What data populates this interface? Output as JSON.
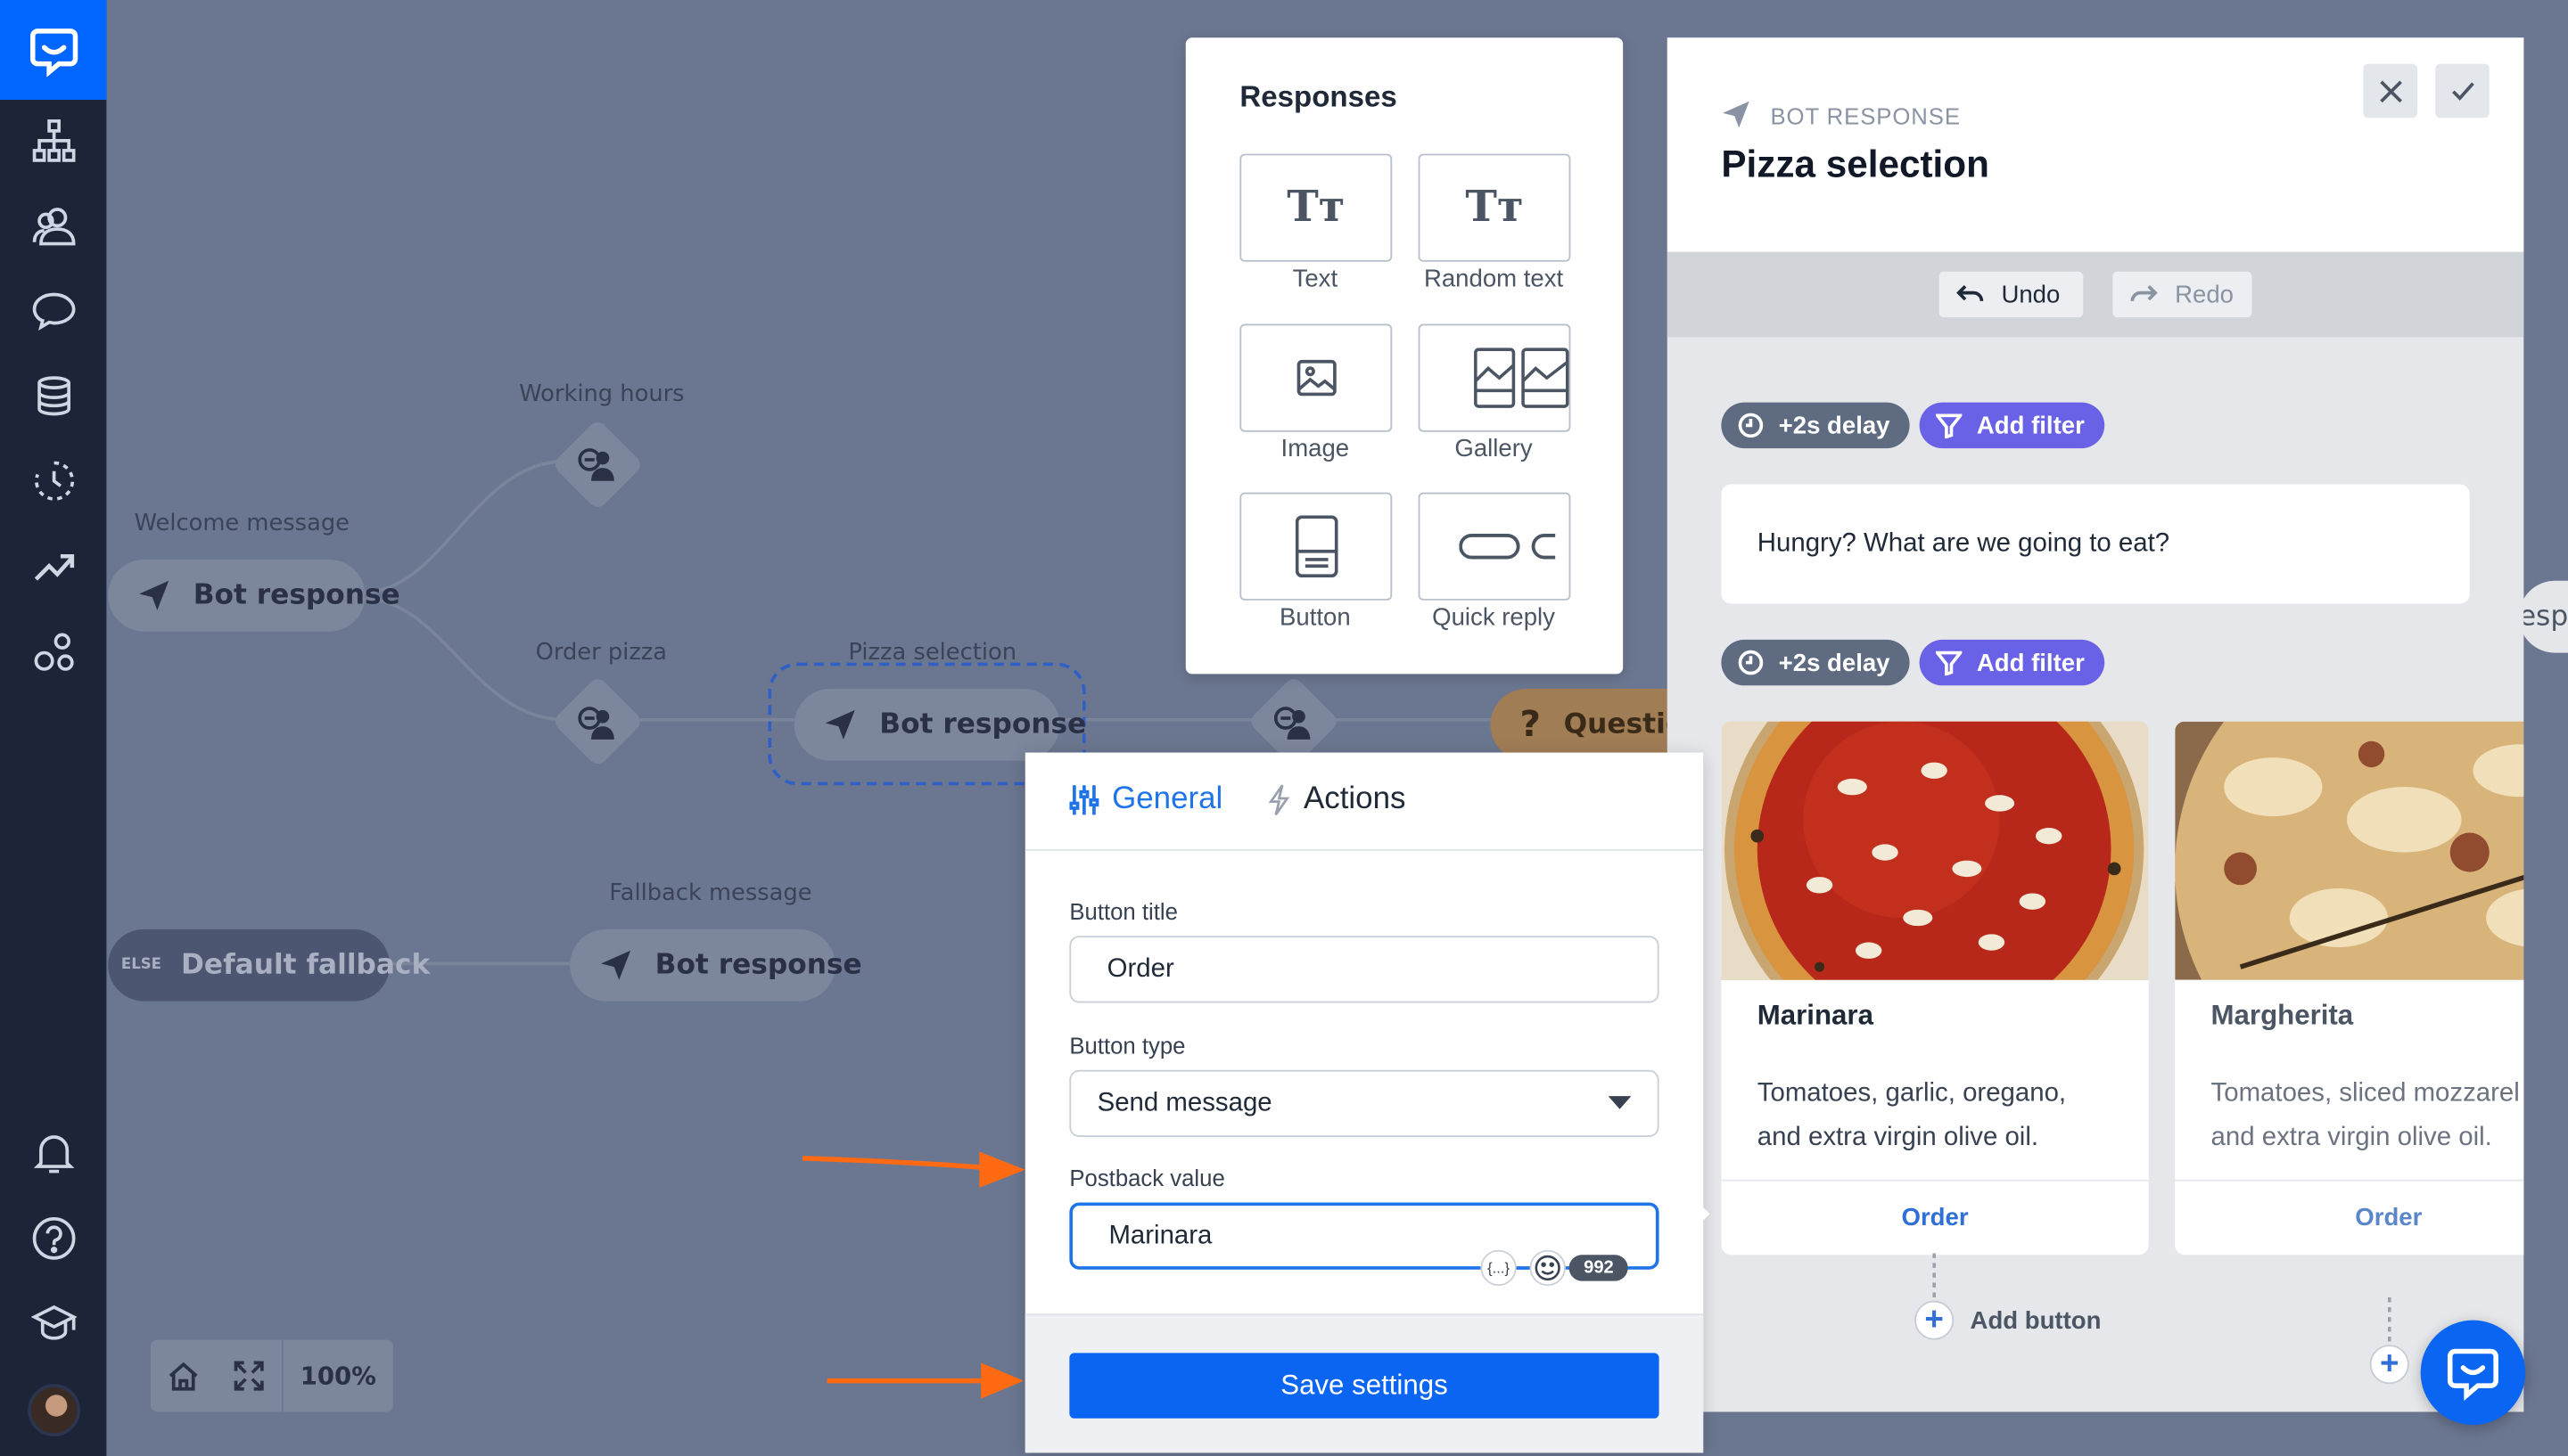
{
  "sidebar": {
    "icons": [
      "chat-logo-icon",
      "sitemap-icon",
      "users-icon",
      "chat-bubble-icon",
      "database-icon",
      "history-icon",
      "trending-icon",
      "integrations-icon",
      "bell-icon",
      "help-icon",
      "graduation-cap-icon"
    ]
  },
  "canvas": {
    "nodes": {
      "working_hours": "Working hours",
      "welcome_message": "Welcome message",
      "welcome_bot": "Bot response",
      "order_pizza": "Order pizza",
      "pizza_selection": "Pizza selection",
      "pizza_bot": "Bot response",
      "question": "Question",
      "fallback_message": "Fallback message",
      "else_tag": "ELSE",
      "default_fallback": "Default fallback",
      "fallback_bot": "Bot response",
      "right_edge_text": "espo"
    },
    "zoom": "100%"
  },
  "responses": {
    "title": "Responses",
    "items": [
      "Text",
      "Random text",
      "Image",
      "Gallery",
      "Button",
      "Quick reply"
    ]
  },
  "bot_panel": {
    "kicker": "BOT RESPONSE",
    "title": "Pizza selection",
    "undo": "Undo",
    "redo": "Redo",
    "delay1": "+2s delay",
    "filter1": "Add filter",
    "message": "Hungry? What are we going to eat?",
    "delay2": "+2s delay",
    "filter2": "Add filter",
    "cards": [
      {
        "title": "Marinara",
        "desc": "Tomatoes, garlic, oregano, and extra virgin olive oil.",
        "button": "Order"
      },
      {
        "title": "Margherita",
        "desc": "Tomatoes, sliced mozzarel basil, and extra virgin olive oil.",
        "button": "Order"
      }
    ],
    "add_button": "Add button"
  },
  "button_modal": {
    "tab_general": "General",
    "tab_actions": "Actions",
    "title_label": "Button title",
    "title_value": "Order",
    "type_label": "Button type",
    "type_value": "Send message",
    "postback_label": "Postback value",
    "postback_value": "Marinara",
    "var_token": "{...}",
    "char_count": "992",
    "save": "Save settings"
  },
  "colors": {
    "accent": "#0a66f2",
    "filter": "#6a62e6",
    "arrow": "#ff6a13"
  }
}
